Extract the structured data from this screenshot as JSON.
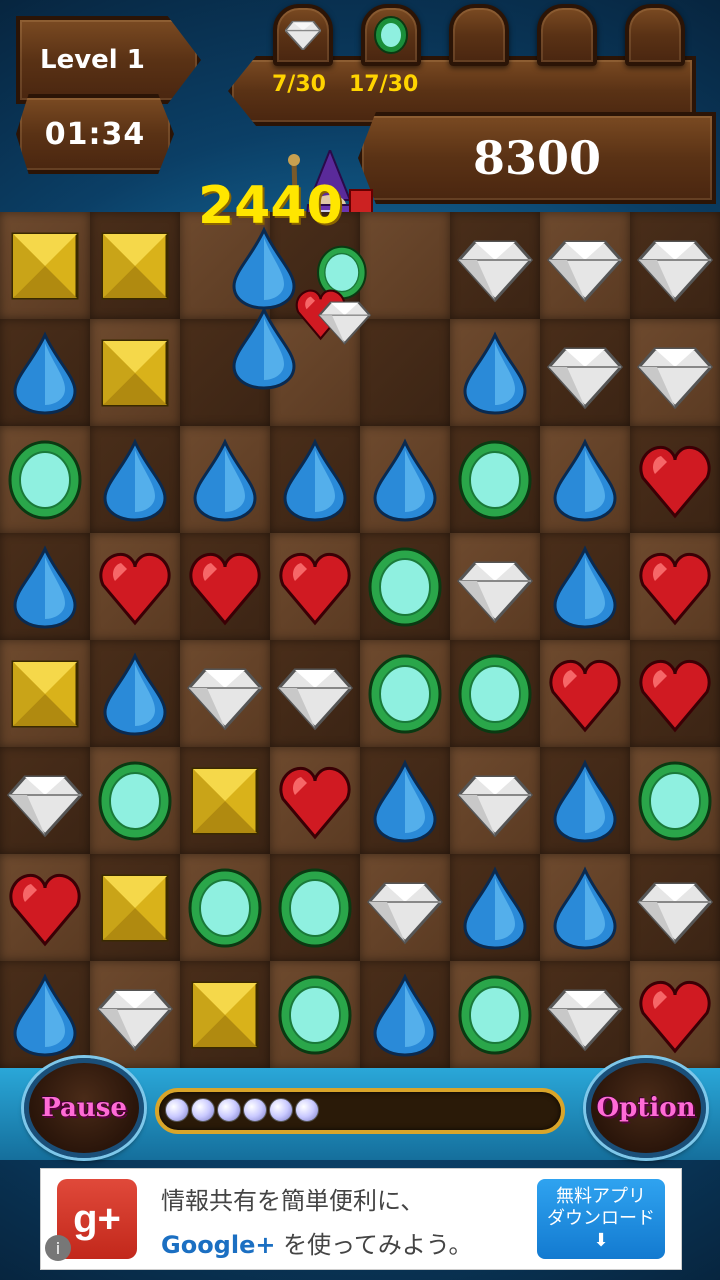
{
  "hud": {
    "level_label": "Level 1",
    "timer": "01:34",
    "score": "8300",
    "combo_popup": "2440",
    "goals": [
      {
        "gem": "diamond",
        "progress": "7/30"
      },
      {
        "gem": "emerald",
        "progress": "17/30"
      }
    ]
  },
  "board": {
    "rows": 8,
    "cols": 8,
    "grid": [
      [
        "topaz",
        "topaz",
        "",
        "",
        "",
        "diamond",
        "diamond",
        "diamond"
      ],
      [
        "sapphire",
        "topaz",
        "",
        "",
        "",
        "sapphire",
        "diamond",
        "diamond"
      ],
      [
        "emerald",
        "sapphire",
        "sapphire",
        "sapphire",
        "sapphire",
        "emerald",
        "sapphire",
        "ruby"
      ],
      [
        "sapphire",
        "ruby",
        "ruby",
        "ruby",
        "emerald",
        "diamond",
        "sapphire",
        "ruby"
      ],
      [
        "topaz",
        "sapphire",
        "diamond",
        "diamond",
        "emerald",
        "emerald",
        "ruby",
        "ruby"
      ],
      [
        "diamond",
        "emerald",
        "topaz",
        "ruby",
        "sapphire",
        "diamond",
        "sapphire",
        "emerald"
      ],
      [
        "ruby",
        "topaz",
        "emerald",
        "emerald",
        "diamond",
        "sapphire",
        "sapphire",
        "diamond"
      ],
      [
        "sapphire",
        "diamond",
        "topaz",
        "emerald",
        "sapphire",
        "emerald",
        "diamond",
        "ruby"
      ]
    ],
    "falling": [
      "sapphire",
      "sapphire",
      "emerald",
      "ruby",
      "diamond"
    ]
  },
  "controls": {
    "pause_label": "Pause",
    "option_label": "Option",
    "progress_fraction": 0.35
  },
  "ad": {
    "logo_text": "g+",
    "line1": "情報共有を簡単便利に、",
    "line2_brand": "Google+",
    "line2_rest": " を使ってみよう。",
    "cta_line1": "無料アプリ",
    "cta_line2": "ダウンロード",
    "cta_arrow": "⬇",
    "info_icon": "i"
  },
  "colors": {
    "combo": "#ffe600",
    "goal_count": "#ffd400",
    "button_text": "#ff6bd6"
  }
}
